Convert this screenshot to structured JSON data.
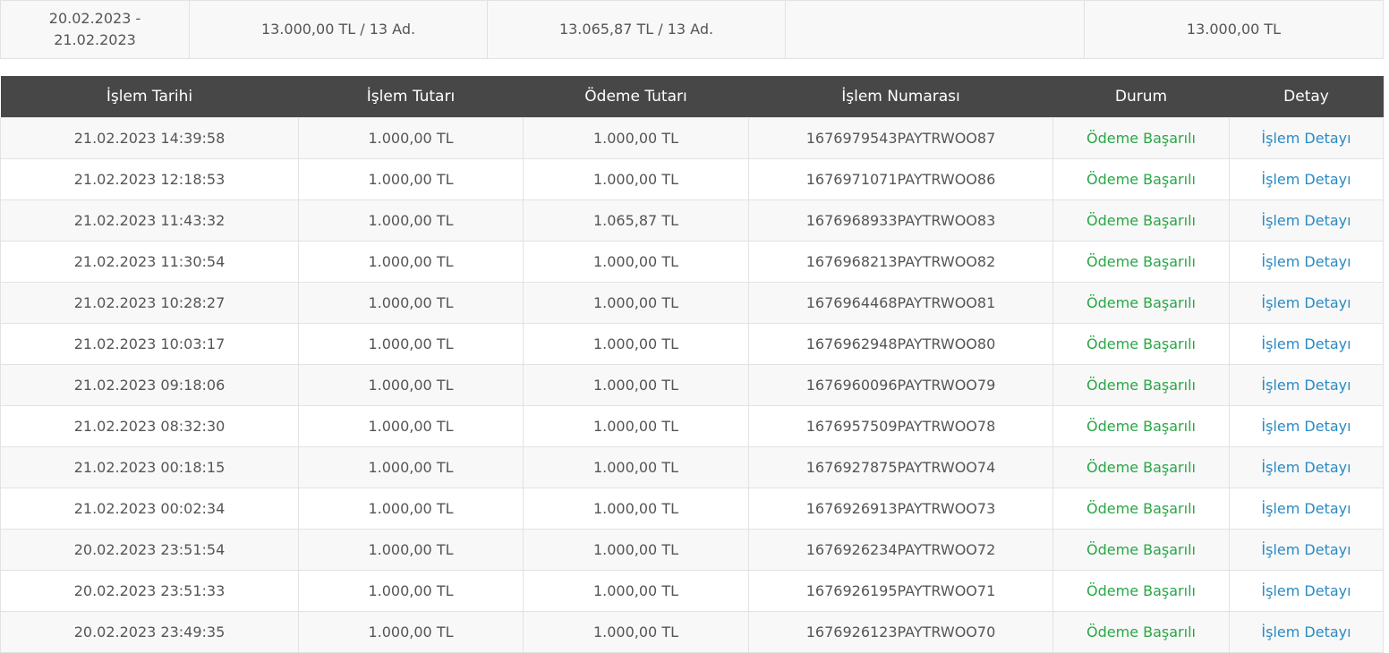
{
  "summary": {
    "period": "20.02.2023 -\n21.02.2023",
    "islem_total": "13.000,00 TL / 13 Ad.",
    "odeme_total": "13.065,87 TL / 13 Ad.",
    "empty": "",
    "net_total": "13.000,00 TL"
  },
  "table": {
    "headers": [
      "İşlem Tarihi",
      "İşlem Tutarı",
      "Ödeme Tutarı",
      "İşlem Numarası",
      "Durum",
      "Detay"
    ],
    "rows": [
      {
        "date": "21.02.2023 14:39:58",
        "islem": "1.000,00 TL",
        "odeme": "1.000,00 TL",
        "no": "1676979543PAYTRWOO87",
        "status": "Ödeme Başarılı",
        "detail": "İşlem Detayı"
      },
      {
        "date": "21.02.2023 12:18:53",
        "islem": "1.000,00 TL",
        "odeme": "1.000,00 TL",
        "no": "1676971071PAYTRWOO86",
        "status": "Ödeme Başarılı",
        "detail": "İşlem Detayı"
      },
      {
        "date": "21.02.2023 11:43:32",
        "islem": "1.000,00 TL",
        "odeme": "1.065,87 TL",
        "no": "1676968933PAYTRWOO83",
        "status": "Ödeme Başarılı",
        "detail": "İşlem Detayı"
      },
      {
        "date": "21.02.2023 11:30:54",
        "islem": "1.000,00 TL",
        "odeme": "1.000,00 TL",
        "no": "1676968213PAYTRWOO82",
        "status": "Ödeme Başarılı",
        "detail": "İşlem Detayı"
      },
      {
        "date": "21.02.2023 10:28:27",
        "islem": "1.000,00 TL",
        "odeme": "1.000,00 TL",
        "no": "1676964468PAYTRWOO81",
        "status": "Ödeme Başarılı",
        "detail": "İşlem Detayı"
      },
      {
        "date": "21.02.2023 10:03:17",
        "islem": "1.000,00 TL",
        "odeme": "1.000,00 TL",
        "no": "1676962948PAYTRWOO80",
        "status": "Ödeme Başarılı",
        "detail": "İşlem Detayı"
      },
      {
        "date": "21.02.2023 09:18:06",
        "islem": "1.000,00 TL",
        "odeme": "1.000,00 TL",
        "no": "1676960096PAYTRWOO79",
        "status": "Ödeme Başarılı",
        "detail": "İşlem Detayı"
      },
      {
        "date": "21.02.2023 08:32:30",
        "islem": "1.000,00 TL",
        "odeme": "1.000,00 TL",
        "no": "1676957509PAYTRWOO78",
        "status": "Ödeme Başarılı",
        "detail": "İşlem Detayı"
      },
      {
        "date": "21.02.2023 00:18:15",
        "islem": "1.000,00 TL",
        "odeme": "1.000,00 TL",
        "no": "1676927875PAYTRWOO74",
        "status": "Ödeme Başarılı",
        "detail": "İşlem Detayı"
      },
      {
        "date": "21.02.2023 00:02:34",
        "islem": "1.000,00 TL",
        "odeme": "1.000,00 TL",
        "no": "1676926913PAYTRWOO73",
        "status": "Ödeme Başarılı",
        "detail": "İşlem Detayı"
      },
      {
        "date": "20.02.2023 23:51:54",
        "islem": "1.000,00 TL",
        "odeme": "1.000,00 TL",
        "no": "1676926234PAYTRWOO72",
        "status": "Ödeme Başarılı",
        "detail": "İşlem Detayı"
      },
      {
        "date": "20.02.2023 23:51:33",
        "islem": "1.000,00 TL",
        "odeme": "1.000,00 TL",
        "no": "1676926195PAYTRWOO71",
        "status": "Ödeme Başarılı",
        "detail": "İşlem Detayı"
      },
      {
        "date": "20.02.2023 23:49:35",
        "islem": "1.000,00 TL",
        "odeme": "1.000,00 TL",
        "no": "1676926123PAYTRWOO70",
        "status": "Ödeme Başarılı",
        "detail": "İşlem Detayı"
      }
    ]
  },
  "colors": {
    "header_bg": "#474747",
    "status_success": "#28a745",
    "link": "#2a8ac4",
    "row_alt": "#f8f8f8"
  }
}
